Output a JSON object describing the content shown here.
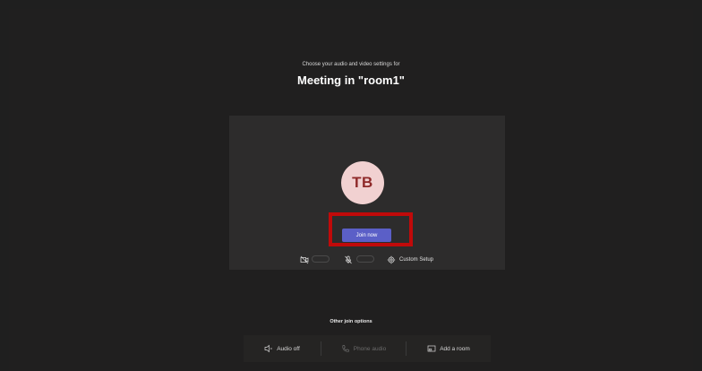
{
  "header": {
    "subtitle": "Choose your audio and video settings for",
    "title": "Meeting in \"room1\""
  },
  "preview": {
    "avatar_initials": "TB",
    "join_label": "Join now",
    "custom_setup_label": "Custom Setup",
    "camera_icon": "camera-icon",
    "mic_icon": "mic-off-icon",
    "settings_icon": "gear-icon"
  },
  "other_options": {
    "heading": "Other join options",
    "items": [
      {
        "label": "Audio off",
        "icon": "speaker-off-icon",
        "enabled": true
      },
      {
        "label": "Phone audio",
        "icon": "phone-icon",
        "enabled": false
      },
      {
        "label": "Add a room",
        "icon": "cast-icon",
        "enabled": true
      }
    ]
  },
  "colors": {
    "background": "#201f1f",
    "card": "#2d2c2c",
    "accent": "#5b5fc7",
    "avatar_bg": "#f1d1d1",
    "avatar_text": "#8f2a2a",
    "highlight": "#c00a0a"
  }
}
